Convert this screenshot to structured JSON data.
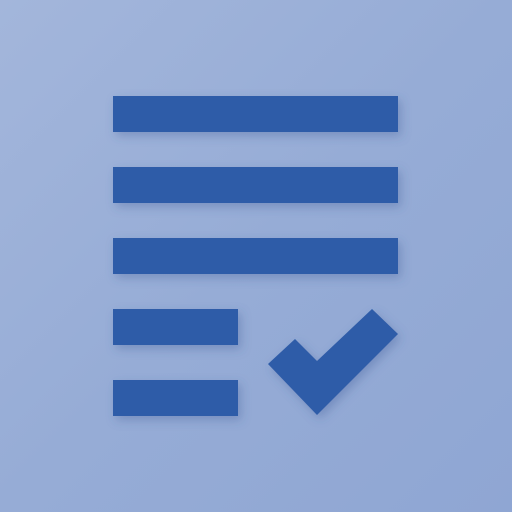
{
  "icon": {
    "name": "checklist-icon",
    "semantic": "document-with-lines-and-checkmark",
    "colors": {
      "background": "#99aed6",
      "glyph": "#2f5ba8",
      "shadow": "#3b5a94"
    },
    "line_count": 5,
    "has_checkmark": true
  }
}
